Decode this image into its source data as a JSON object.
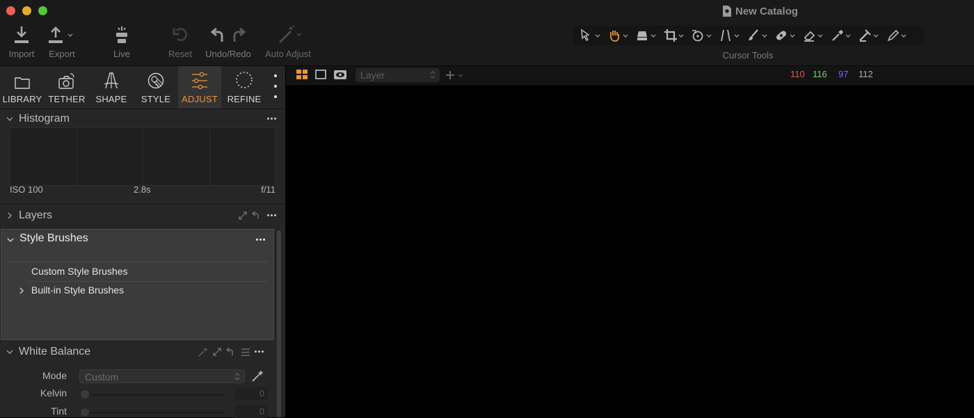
{
  "window": {
    "title": "New Catalog"
  },
  "toolbar": {
    "import": "Import",
    "export": "Export",
    "live": "Live",
    "reset": "Reset",
    "undo_redo": "Undo/Redo",
    "auto_adjust": "Auto Adjust",
    "cursor_tools": "Cursor Tools"
  },
  "tabs": [
    {
      "label": "LIBRARY",
      "icon": "folder-icon"
    },
    {
      "label": "TETHER",
      "icon": "camera-icon"
    },
    {
      "label": "SHAPE",
      "icon": "shape-icon"
    },
    {
      "label": "STYLE",
      "icon": "style-icon"
    },
    {
      "label": "ADJUST",
      "icon": "sliders-icon",
      "active": true
    },
    {
      "label": "REFINE",
      "icon": "refine-icon"
    }
  ],
  "histogram": {
    "title": "Histogram",
    "iso": "ISO 100",
    "shutter": "2.8s",
    "aperture": "f/11"
  },
  "layers": {
    "title": "Layers"
  },
  "style_brushes": {
    "title": "Style Brushes",
    "items": [
      "Custom Style Brushes",
      "Built-in Style Brushes"
    ]
  },
  "white_balance": {
    "title": "White Balance",
    "mode_label": "Mode",
    "mode_value": "Custom",
    "kelvin_label": "Kelvin",
    "kelvin_value": "0",
    "tint_label": "Tint",
    "tint_value": "0"
  },
  "viewer": {
    "layer_placeholder": "Layer",
    "readout": {
      "r": "110",
      "g": "116",
      "b": "97",
      "l": "112"
    }
  },
  "colors": {
    "accent": "#e8963a",
    "readout_r": "#e05a46",
    "readout_g": "#7ccf6a",
    "readout_b": "#6a6af2",
    "readout_l": "#b0b0b0"
  }
}
